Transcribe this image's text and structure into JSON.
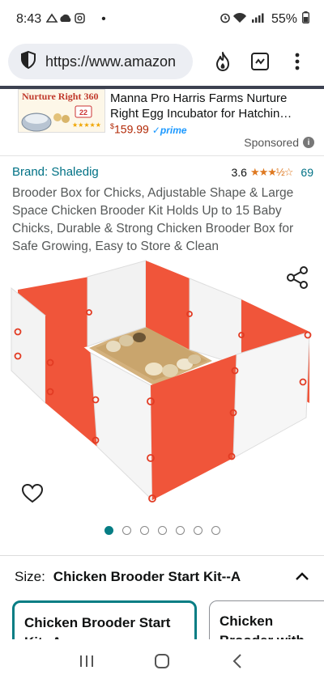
{
  "status_bar": {
    "time": "8:43",
    "dot": "•",
    "battery": "55%"
  },
  "browser": {
    "url": "https://www.amazon",
    "icons": [
      "shield-icon",
      "fire-icon",
      "tab-switcher-icon",
      "more-vert-icon"
    ]
  },
  "ad": {
    "thumb_logo": "Nurture Right 360",
    "thumb_badge": "22",
    "title": "Manna Pro Harris Farms Nurture Right Egg Incubator for Hatchin…",
    "price_symbol": "$",
    "price": "159.99",
    "prime": "✓prime",
    "sponsored": "Sponsored",
    "info_glyph": "i"
  },
  "product": {
    "brand": "Brand: Shaledig",
    "rating_value": "3.6",
    "stars": "★★★½☆",
    "rating_count": "69",
    "title": "Brooder Box for Chicks, Adjustable Shape & Large Space Chicken Brooder Kit Holds Up to 15 Baby Chicks, Durable & Strong Chicken Brooder Box for Safe Growing, Easy to Store & Clean",
    "image_count": 7,
    "active_image": 0
  },
  "size": {
    "label": "Size:",
    "value": "Chicken Brooder Start Kit--A"
  },
  "options": [
    {
      "label": "Chicken Brooder Start Kit--A",
      "selected": true
    },
    {
      "label": "Chicken Brooder with Brooder H",
      "selected": false
    }
  ],
  "colors": {
    "accent": "#067d84",
    "link": "#007185",
    "star": "#de7921",
    "price": "#b12704",
    "panel_orange": "#f0553a"
  }
}
